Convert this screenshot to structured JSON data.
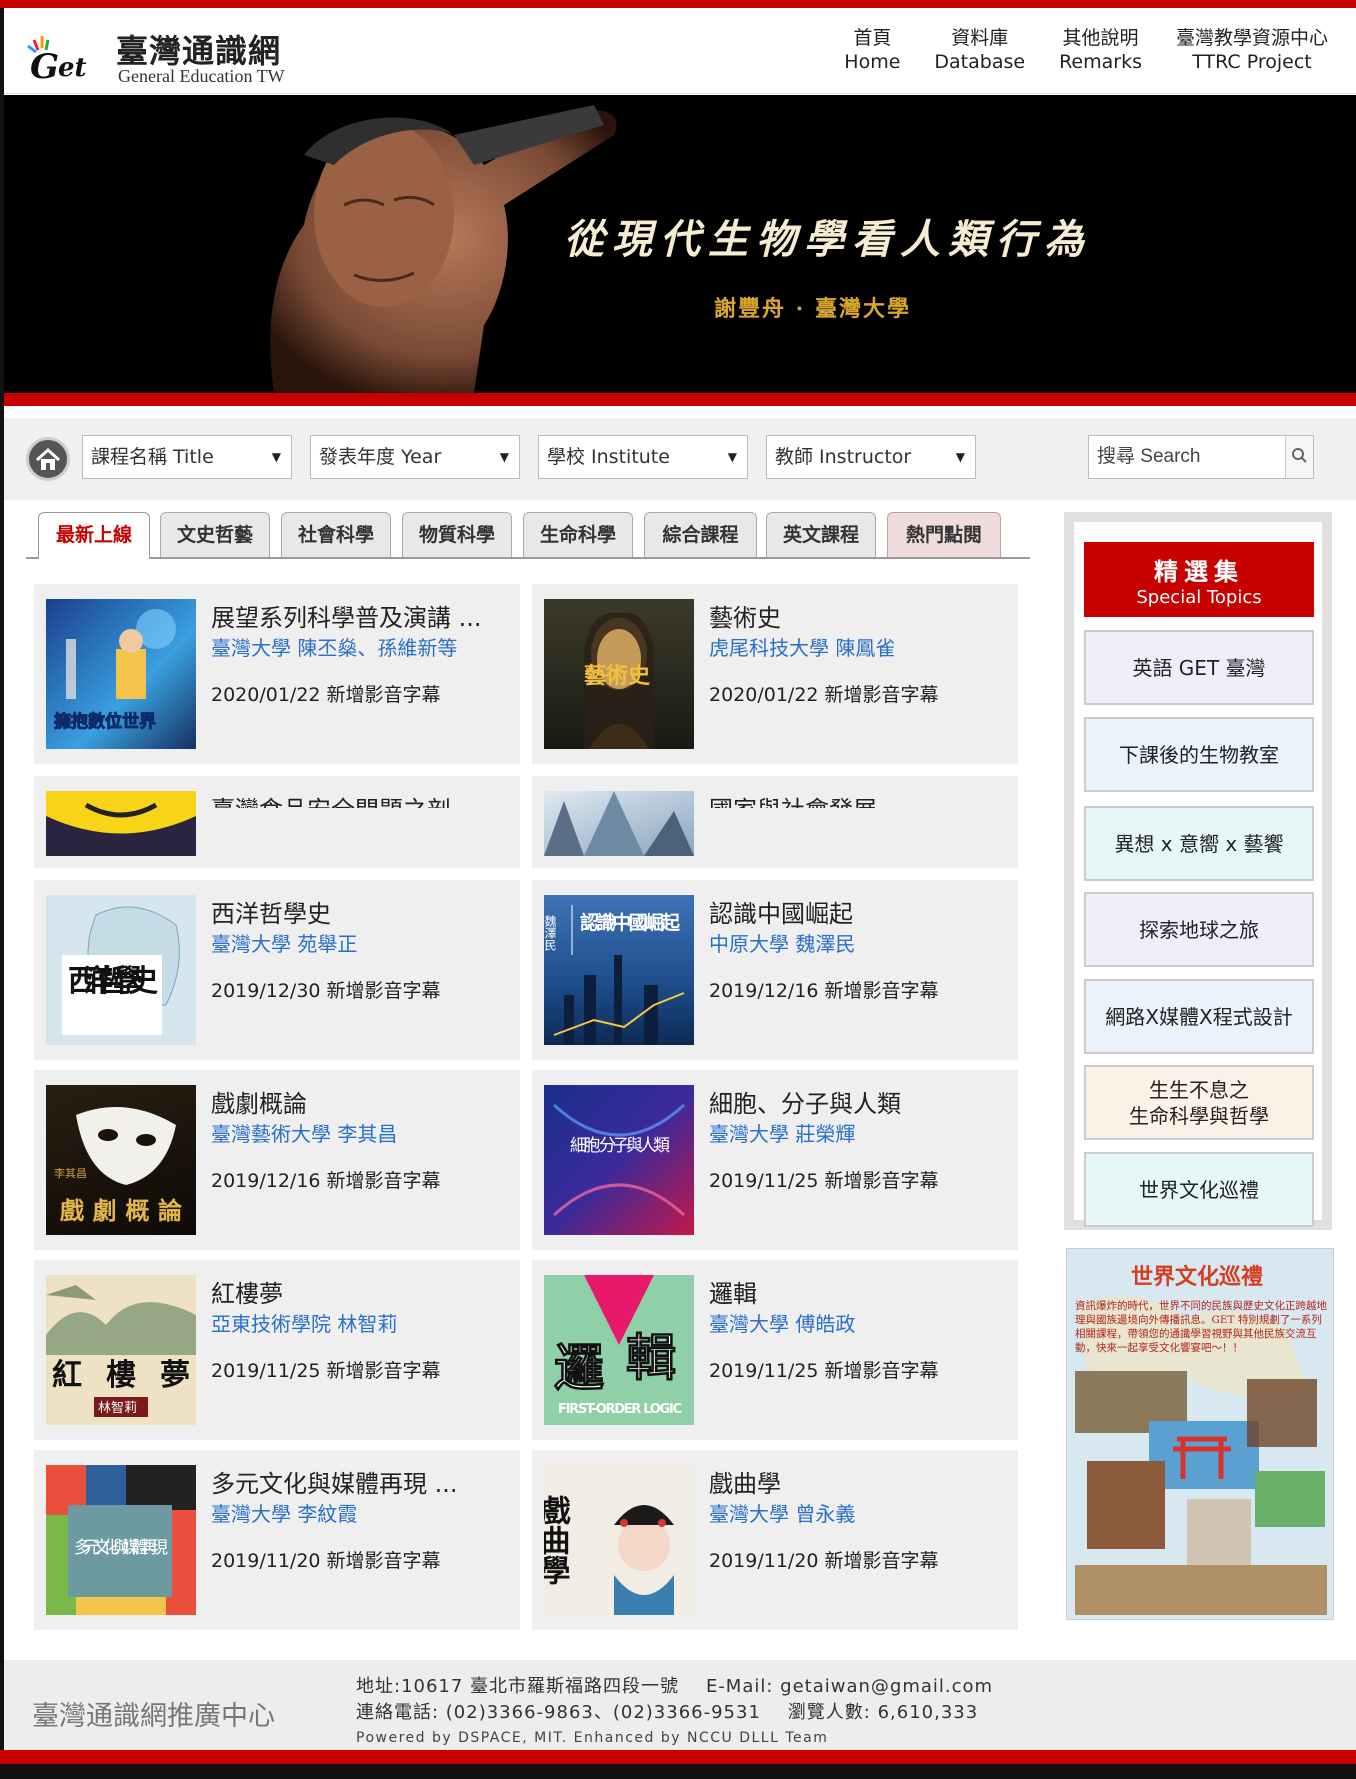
{
  "header": {
    "logo_title": "臺灣通識網",
    "logo_sub": "General Education TW",
    "nav": [
      {
        "zh": "首頁",
        "en": "Home"
      },
      {
        "zh": "資料庫",
        "en": "Database"
      },
      {
        "zh": "其他說明",
        "en": "Remarks"
      },
      {
        "zh": "臺灣教學資源中心",
        "en": "TTRC Project"
      }
    ]
  },
  "banner": {
    "title": "從現代生物學看人類行為",
    "subtitle": "謝豐舟 · 臺灣大學"
  },
  "filters": {
    "title": "課程名稱 Title",
    "year": "發表年度 Year",
    "institute": "學校 Institute",
    "instructor": "教師 Instructor",
    "search_placeholder": "搜尋 Search"
  },
  "tabs": [
    "最新上線",
    "文史哲藝",
    "社會科學",
    "物質科學",
    "生命科學",
    "綜合課程",
    "英文課程",
    "熱門點閱"
  ],
  "courses": [
    {
      "title": "展望系列科學普及演講 ...",
      "school": "臺灣大學",
      "teacher": "陳丕燊、孫維新等",
      "date": "2020/01/22 新增影音字幕"
    },
    {
      "title": "藝術史",
      "school": "虎尾科技大學",
      "teacher": "陳鳳雀",
      "date": "2020/01/22 新增影音字幕"
    },
    {
      "title": "臺灣食品安全問題之剖",
      "school": "",
      "teacher": "",
      "date": ""
    },
    {
      "title": "國家與社會發展",
      "school": "",
      "teacher": "",
      "date": ""
    },
    {
      "title": "西洋哲學史",
      "school": "臺灣大學",
      "teacher": "苑舉正",
      "date": "2019/12/30 新增影音字幕"
    },
    {
      "title": "認識中國崛起",
      "school": "中原大學",
      "teacher": "魏澤民",
      "date": "2019/12/16 新增影音字幕"
    },
    {
      "title": "戲劇概論",
      "school": "臺灣藝術大學",
      "teacher": "李其昌",
      "date": "2019/12/16 新增影音字幕"
    },
    {
      "title": "細胞、分子與人類",
      "school": "臺灣大學",
      "teacher": "莊榮輝",
      "date": "2019/11/25 新增影音字幕"
    },
    {
      "title": "紅樓夢",
      "school": "亞東技術學院",
      "teacher": "林智莉",
      "date": "2019/11/25 新增影音字幕"
    },
    {
      "title": "邏輯",
      "school": "臺灣大學",
      "teacher": "傅皓政",
      "date": "2019/11/25 新增影音字幕"
    },
    {
      "title": "多元文化與媒體再現 ...",
      "school": "臺灣大學",
      "teacher": "李紋霞",
      "date": "2019/11/20 新增影音字幕"
    },
    {
      "title": "戲曲學",
      "school": "臺灣大學",
      "teacher": "曾永義",
      "date": "2019/11/20 新增影音字幕"
    }
  ],
  "thumb_text": {
    "c0": "擁抱數位世界",
    "c1": "藝術史",
    "c4": "西洋哲學史",
    "c5": "認識中國崛起",
    "c5_side": "魏澤民",
    "c6": "戲劇概論",
    "c6_side": "李其昌",
    "c7": "細胞 分子與人類",
    "c8": "紅樓夢",
    "c8_tag": "林智莉",
    "c9_a": "邏",
    "c9_b": "輯",
    "c9_en": "FIRST-ORDER LOGIC",
    "c10": "多元文化與媒體再現",
    "c11": "戲曲學"
  },
  "sidebar": {
    "head_zh": "精選集",
    "head_en": "Special Topics",
    "topics": [
      {
        "label": "英語 GET 臺灣",
        "bg": "#f1eefb"
      },
      {
        "label": "下課後的生物教室",
        "bg": "#eaf2fb"
      },
      {
        "label": "異想 x 意嚮 x 藝饗",
        "bg": "#e6f7f7"
      },
      {
        "label": "探索地球之旅",
        "bg": "#f1eefb"
      },
      {
        "label": "網路X媒體X程式設計",
        "bg": "#eaf2fb"
      },
      {
        "label": "生生不息之\n生命科學與哲學",
        "bg": "#fcf1e7"
      },
      {
        "label": "世界文化巡禮",
        "bg": "#e6f7f7"
      }
    ],
    "promo_title": "世界文化巡禮",
    "promo_text": "資訊爆炸的時代，世界不同的民族與歷史文化正跨越地理與國族邊境向外傳播訊息。GET 特別規劃了一系列相關課程，帶領您的通識學習視野與其他民族交流互動，快來一起享受文化饗宴吧～！！"
  },
  "footer": {
    "org": "臺灣通識網推廣中心",
    "address": "地址:10617 臺北市羅斯福路四段一號",
    "email": "E-Mail: getaiwan@gmail.com",
    "phone": "連絡電話: (02)3366-9863、(02)3366-9531",
    "views": "瀏覽人數: 6,610,333",
    "powered": "Powered by DSPACE, MIT. Enhanced by NCCU DLLL Team"
  }
}
